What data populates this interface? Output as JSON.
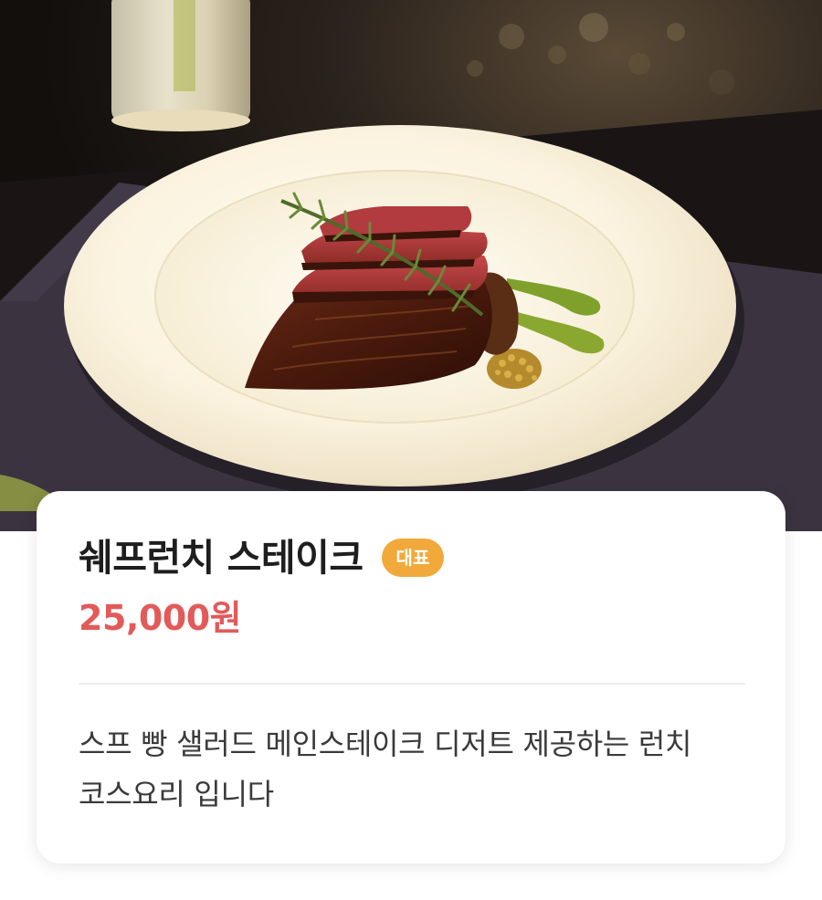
{
  "menu": {
    "name": "쉐프런치 스테이크",
    "badge": "대표",
    "price": "25,000원",
    "description": "스프 빵 샐러드 메인스테이크 디저트 제공하는 런치 코스요리 입니다"
  },
  "photo": {
    "subject": "steak-plate-photo"
  },
  "colors": {
    "price": "#e25a5a",
    "badge_bg": "#f2a93b",
    "title": "#1e1e1e",
    "description": "#3a3a3a"
  }
}
